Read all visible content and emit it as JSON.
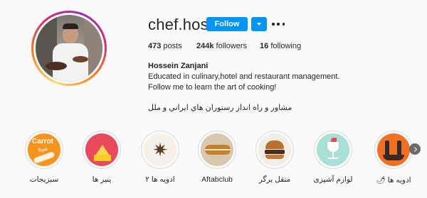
{
  "profile": {
    "username": "chef.hosiz",
    "follow_label": "Follow",
    "stats": {
      "posts_count": "473",
      "posts_label": "posts",
      "followers_count": "244k",
      "followers_label": "followers",
      "following_count": "16",
      "following_label": "following"
    },
    "bio": {
      "full_name": "Hossein Zanjani",
      "line1": "Educated in culinary,hotel and restaurant management.",
      "line2": "Follow me to learn the art of cooking!",
      "line3": "مشاور و راه انداز رستوران هاي ايراني و ملل"
    }
  },
  "highlights": [
    {
      "label": "سبزیجات",
      "thumb_text": "Carrot",
      "thumb_subtext": "هويج",
      "icon": "carrot-icon",
      "color": "#f7941d"
    },
    {
      "label": "پنیر ها",
      "icon": "cheese-icon",
      "color": "#e8495b"
    },
    {
      "label": "ادویه ها ۲",
      "icon": "star-anise-icon",
      "color": "#f5f1ea"
    },
    {
      "label": "Aftabclub",
      "icon": "pastry-icon",
      "color": "#d9c8b0"
    },
    {
      "label": "منقل برگر",
      "icon": "burger-icon",
      "color": "#f2ede6"
    },
    {
      "label": "لوازم آشپزی",
      "icon": "kitchen-tools-icon",
      "color": "#a8e0d6"
    },
    {
      "label": "ادویه ها 🌶",
      "icon": "spice-grinder-icon",
      "color": "#f36f21"
    }
  ],
  "colors": {
    "accent": "#0095f6",
    "text": "#262626",
    "background": "#fafafa"
  }
}
